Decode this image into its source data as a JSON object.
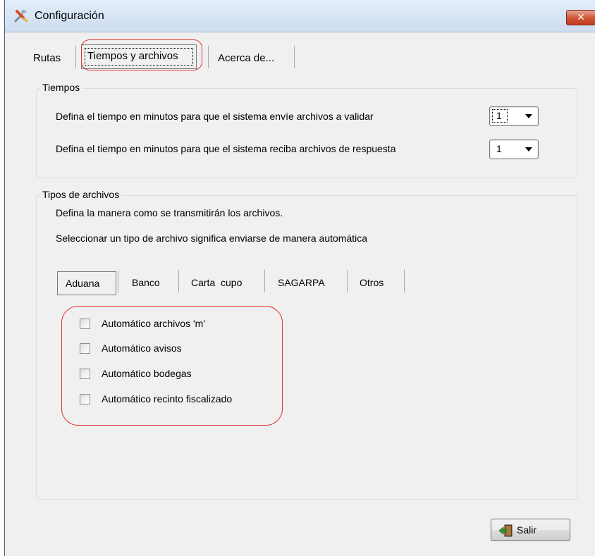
{
  "window": {
    "title": "Configuración",
    "close_glyph": "✕"
  },
  "tabs": [
    {
      "label": "Rutas"
    },
    {
      "label": "Tiempos y archivos"
    },
    {
      "label": "Acerca de..."
    }
  ],
  "tiempos": {
    "group_title": "Tiempos",
    "send_label": "Defina el tiempo en minutos para que el sistema envíe archivos a validar",
    "send_value": "1",
    "receive_label": "Defina el tiempo en minutos para que el sistema reciba archivos de respuesta",
    "receive_value": "1"
  },
  "tipos": {
    "group_title": "Tipos de archivos",
    "line1": "Defina la manera como se transmitirán los archivos.",
    "line2": "Seleccionar un tipo de archivo significa enviarse de manera automática",
    "subtabs": [
      {
        "label": "Aduana"
      },
      {
        "label": "Banco"
      },
      {
        "label": "Carta  cupo"
      },
      {
        "label": "SAGARPA"
      },
      {
        "label": "Otros"
      }
    ],
    "checkboxes": [
      {
        "label": "Automático archivos 'm'",
        "checked": false
      },
      {
        "label": "Automático avisos",
        "checked": false
      },
      {
        "label": "Automático bodegas",
        "checked": false
      },
      {
        "label": "Automático recinto fiscalizado",
        "checked": false
      }
    ]
  },
  "footer": {
    "exit_label": "Salir"
  },
  "colors": {
    "highlight": "#e03232",
    "titlebar": "#dbe7f5",
    "close": "#c9432a"
  },
  "icons": {
    "app": "wrench-screwdriver-icon",
    "exit": "exit-door-icon",
    "dropdown": "chevron-down-icon"
  }
}
